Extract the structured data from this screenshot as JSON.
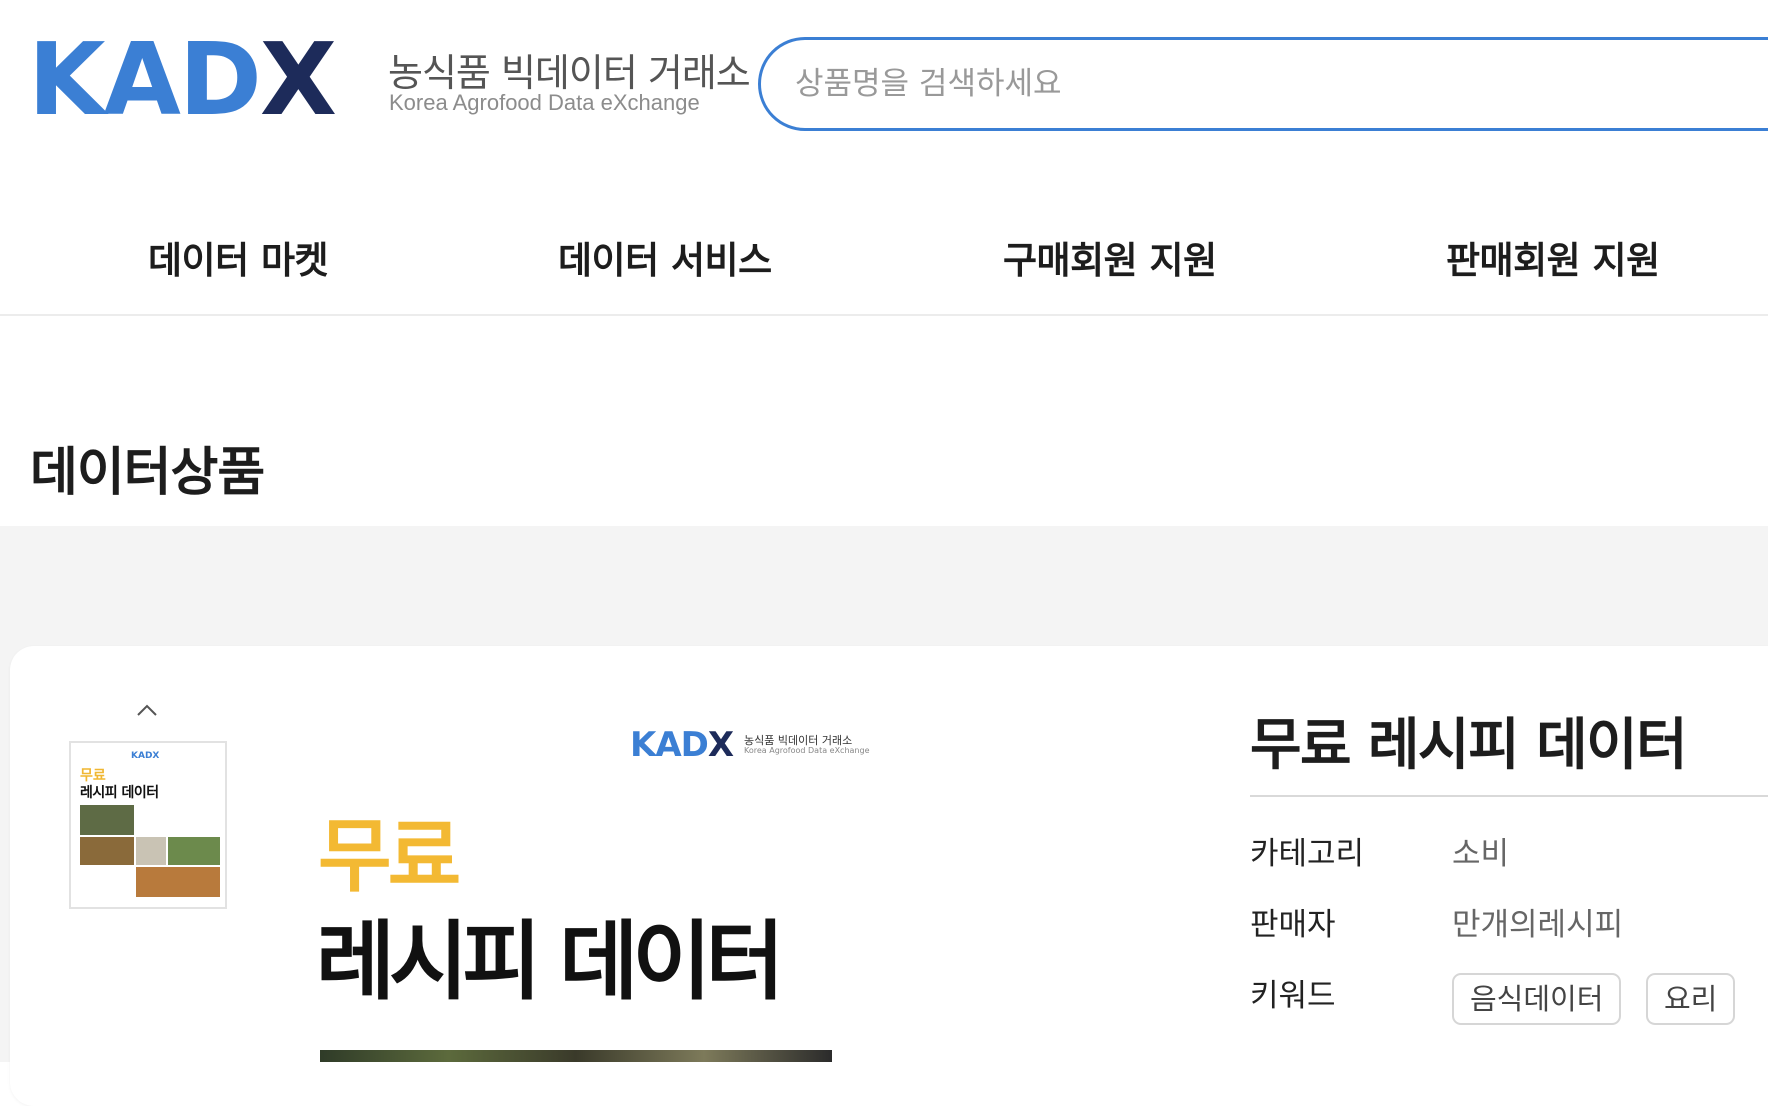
{
  "header": {
    "logo_mark_k": "KAD",
    "logo_mark_x": "X",
    "logo_ko": "농식품 빅데이터 거래소",
    "logo_en": "Korea Agrofood Data eXchange"
  },
  "search": {
    "placeholder": "상품명을 검색하세요"
  },
  "nav": {
    "items": [
      {
        "label": "데이터 마켓"
      },
      {
        "label": "데이터 서비스"
      },
      {
        "label": "구매회원 지원"
      },
      {
        "label": "판매회원 지원"
      }
    ]
  },
  "page_title": "데이터상품",
  "thumbnail": {
    "title_1": "무료",
    "title_2": "레시피 데이터"
  },
  "preview": {
    "logo_ko": "농식품 빅데이터 거래소",
    "logo_en": "Korea Agrofood Data eXchange",
    "title_1": "무료",
    "title_2": "레시피 데이터"
  },
  "product": {
    "title": "무료 레시피 데이터",
    "category_label": "카테고리",
    "category_value": "소비",
    "seller_label": "판매자",
    "seller_value": "만개의레시피",
    "keyword_label": "키워드",
    "keywords": [
      "음식데이터",
      "요리"
    ]
  },
  "colors": {
    "brand_blue": "#3b7fd4",
    "brand_navy": "#1d2b5a",
    "accent_yellow": "#f3b933"
  }
}
